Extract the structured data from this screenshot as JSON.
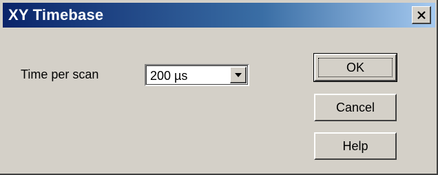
{
  "window": {
    "title": "XY Timebase"
  },
  "form": {
    "time_per_scan_label": "Time per scan",
    "time_per_scan_value": "200 µs"
  },
  "buttons": {
    "ok": "OK",
    "cancel": "Cancel",
    "help": "Help"
  },
  "icons": {
    "close": "close-icon",
    "dropdown": "chevron-down-icon"
  },
  "colors": {
    "title_bar_start": "#0a246a",
    "title_bar_end": "#a6caf0",
    "dialog_background": "#d4d0c8"
  }
}
